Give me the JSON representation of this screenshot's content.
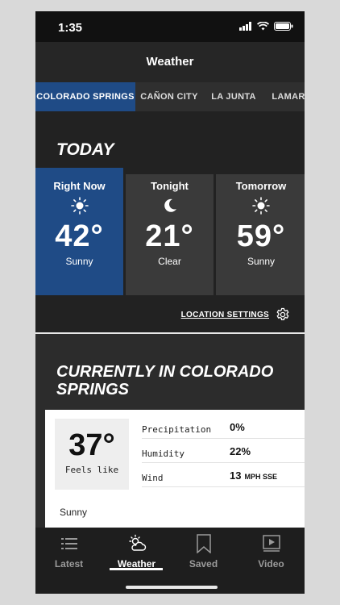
{
  "status": {
    "time": "1:35"
  },
  "header": {
    "title": "Weather"
  },
  "tabs": [
    {
      "label": "COLORADO SPRINGS",
      "active": true
    },
    {
      "label": "CAÑON CITY",
      "active": false
    },
    {
      "label": "LA JUNTA",
      "active": false
    },
    {
      "label": "LAMAR",
      "active": false
    }
  ],
  "today": {
    "title": "TODAY",
    "cards": [
      {
        "label": "Right Now",
        "icon": "sun-icon",
        "temp": "42°",
        "condition": "Sunny"
      },
      {
        "label": "Tonight",
        "icon": "moon-icon",
        "temp": "21°",
        "condition": "Clear"
      },
      {
        "label": "Tomorrow",
        "icon": "sun-icon",
        "temp": "59°",
        "condition": "Sunny"
      }
    ],
    "location_settings": "LOCATION SETTINGS"
  },
  "current": {
    "title": "CURRENTLY IN COLORADO SPRINGS",
    "feels_temp": "37°",
    "feels_label": "Feels like",
    "stats": [
      {
        "name": "Precipitation",
        "value": "0%",
        "unit": ""
      },
      {
        "name": "Humidity",
        "value": "22%",
        "unit": ""
      },
      {
        "name": "Wind",
        "value": "13",
        "unit": "MPH SSE"
      }
    ],
    "condition": "Sunny"
  },
  "nav": [
    {
      "label": "Latest",
      "icon": "list-icon",
      "active": false
    },
    {
      "label": "Weather",
      "icon": "weather-icon",
      "active": true
    },
    {
      "label": "Saved",
      "icon": "bookmark-icon",
      "active": false
    },
    {
      "label": "Video",
      "icon": "video-icon",
      "active": false
    }
  ],
  "colors": {
    "accent": "#1f4b86",
    "dark": "#1c1c1c",
    "card": "#3a3a3a"
  }
}
